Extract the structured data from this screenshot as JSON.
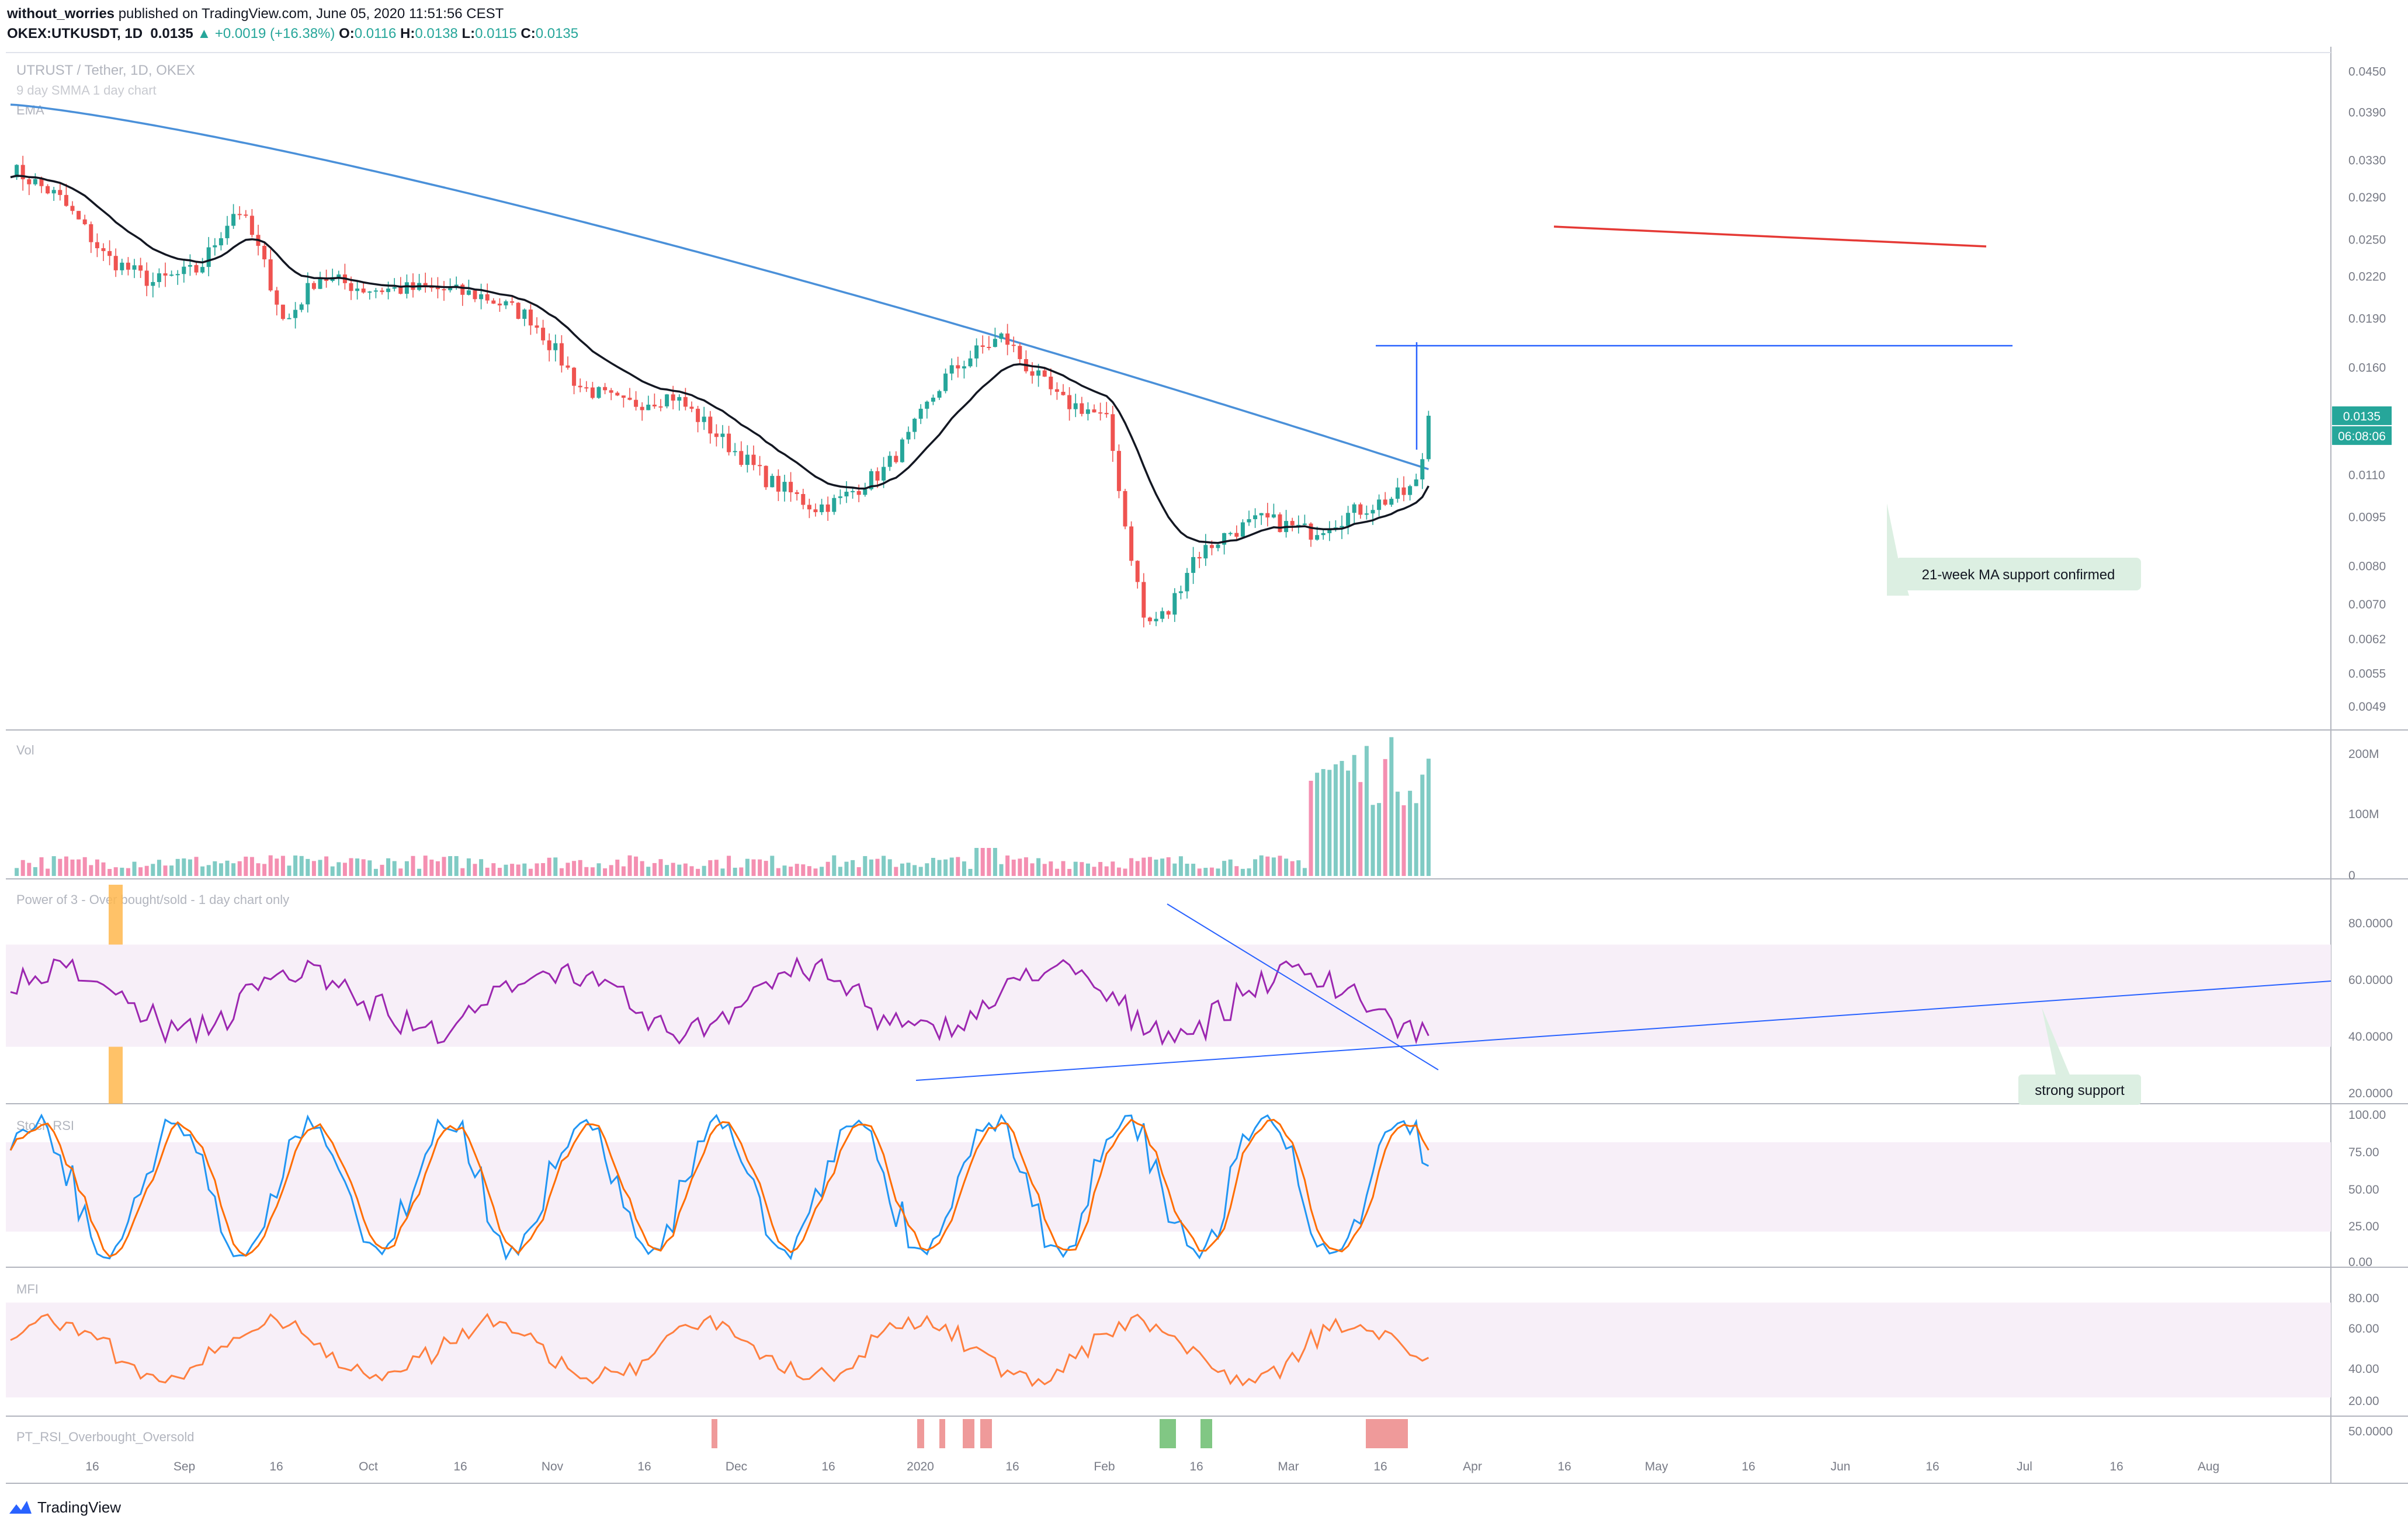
{
  "header": {
    "author": "without_worries",
    "published_text": "published on TradingView.com, June 05, 2020 11:51:56 CEST",
    "symbol": "OKEX:UTKUSDT, 1D",
    "last": "0.0135",
    "change": "+0.0019 (+16.38%)",
    "o_label": "O:",
    "o_value": "0.0116",
    "h_label": "H:",
    "h_value": "0.0138",
    "l_label": "L:",
    "l_value": "0.0115",
    "c_label": "C:",
    "c_value": "0.0135"
  },
  "chart_data": [
    {
      "type": "candlestick",
      "title": "UTRUST / Tether, 1D, OKEX",
      "legend": [
        "9 day SMMA 1 day chart",
        "EMA"
      ],
      "y_axis_labels": [
        "0.0450",
        "0.0390",
        "0.0330",
        "0.0290",
        "0.0250",
        "0.0220",
        "0.0190",
        "0.0160",
        "0.0135",
        "0.0110",
        "0.0095",
        "0.0080",
        "0.0070",
        "0.0062",
        "0.0055",
        "0.0049"
      ],
      "last_price_label": "0.0135",
      "countdown_label": "06:08:06",
      "x_tick_labels": [
        "16",
        "Sep",
        "16",
        "Oct",
        "16",
        "Nov",
        "16",
        "Dec",
        "16",
        "2020",
        "16",
        "Feb",
        "16",
        "Mar",
        "16",
        "Apr",
        "16",
        "May",
        "16",
        "Jun",
        "16",
        "Jul",
        "16",
        "Aug"
      ],
      "ohlc_last": {
        "open": 0.0116,
        "high": 0.0138,
        "low": 0.0115,
        "close": 0.0135
      },
      "annotations": [
        "21-week MA support confirmed"
      ],
      "colors": {
        "up": "#26a69a",
        "down": "#ef5350",
        "ma_blue": "#4a90d9",
        "ema_black": "#131722",
        "red_line": "#e53935",
        "hline": "#2962ff"
      }
    },
    {
      "type": "bar",
      "title": "Vol",
      "y_axis_labels": [
        "200M",
        "100M",
        "0"
      ]
    },
    {
      "type": "line",
      "title": "Power of 3 - Over bought/sold - 1 day chart only",
      "y_axis_labels": [
        "80.0000",
        "60.0000",
        "40.0000",
        "20.0000"
      ],
      "band": [
        30,
        70
      ],
      "annotations": [
        "strong support"
      ],
      "colors": {
        "line": "#9c27b0",
        "band": "#f3e5f5",
        "highlight": "#ffb74d"
      }
    },
    {
      "type": "line",
      "title": "Stoch RSI",
      "y_axis_labels": [
        "100.00",
        "75.00",
        "50.00",
        "25.00",
        "0.00"
      ],
      "band": [
        20,
        80
      ],
      "colors": {
        "k": "#2196f3",
        "d": "#ff6d00"
      }
    },
    {
      "type": "line",
      "title": "MFI",
      "y_axis_labels": [
        "80.00",
        "60.00",
        "40.00",
        "20.00"
      ],
      "band": [
        20,
        80
      ],
      "colors": {
        "line": "#ff7f3f"
      }
    },
    {
      "type": "bar",
      "title": "PT_RSI_Overbought_Oversold",
      "y_axis_labels": [
        "50.0000"
      ],
      "colors": {
        "overbought": "#ef9a9a",
        "oversold": "#81c784"
      }
    }
  ],
  "footer": {
    "brand": "TradingView"
  }
}
